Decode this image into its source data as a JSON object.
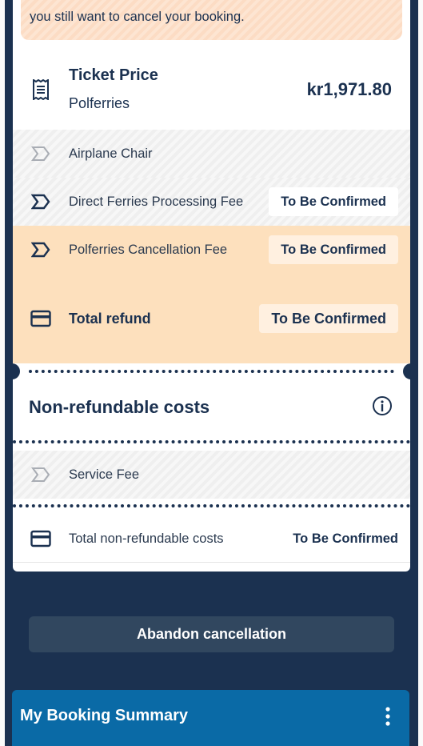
{
  "warning": {
    "text": "you still want to cancel your booking."
  },
  "ticket": {
    "title": "Ticket Price",
    "operator": "Polferries",
    "price": "kr1,971.80"
  },
  "items": [
    {
      "label": "Airplane Chair"
    },
    {
      "label": "Direct Ferries Processing Fee",
      "status": "To Be Confirmed"
    },
    {
      "label": "Polferries Cancellation Fee",
      "status": "To Be Confirmed"
    }
  ],
  "total_refund": {
    "label": "Total refund",
    "status": "To Be Confirmed"
  },
  "non_refundable": {
    "title": "Non-refundable costs",
    "items": [
      {
        "label": "Service Fee"
      }
    ],
    "total": {
      "label": "Total non-refundable costs",
      "status": "To Be Confirmed"
    }
  },
  "actions": {
    "abandon_label": "Abandon cancellation"
  },
  "summary": {
    "title": "My Booking Summary"
  },
  "colors": {
    "navy": "#1b3150",
    "orange": "#fde0bd",
    "blue": "#0a6aa6"
  },
  "icons": [
    "receipt-icon",
    "chevron-tag-icon",
    "credit-card-icon",
    "info-icon",
    "kebab-menu-icon"
  ]
}
